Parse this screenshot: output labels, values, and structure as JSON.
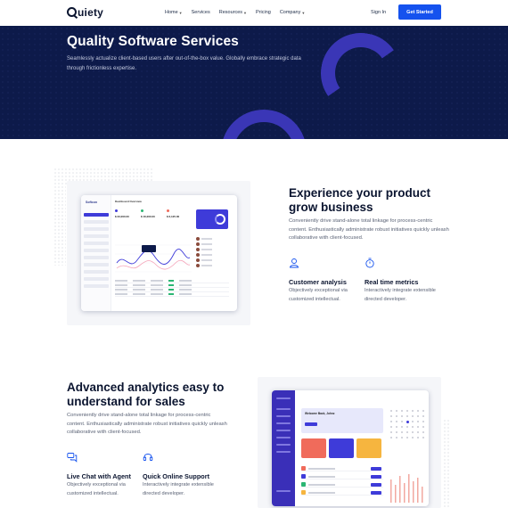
{
  "nav": {
    "logo": "uiety",
    "items": [
      {
        "label": "Home",
        "dropdown": true
      },
      {
        "label": "Services",
        "dropdown": false
      },
      {
        "label": "Resources",
        "dropdown": true
      },
      {
        "label": "Pricing",
        "dropdown": false
      },
      {
        "label": "Company",
        "dropdown": true
      }
    ],
    "sign_in": "Sign In",
    "cta": "Get Started"
  },
  "hero": {
    "title": "Quality Software Services",
    "text": "Seamlessly actualize client-based users after out-of-the-box value. Globally embrace strategic data through frictionless expertise."
  },
  "section2": {
    "title": "Experience your product grow business",
    "text": "Conveniently drive stand-alone total linkage for process-centric content. Enthusiastically administrate robust initiatives quickly unleash collaborative with client-focused.",
    "features": [
      {
        "icon": "user-icon",
        "title": "Customer analysis",
        "text": "Objectively exceptional via customized intellectual."
      },
      {
        "icon": "stopwatch-icon",
        "title": "Real time metrics",
        "text": "Interactively integrate extensible directed developer."
      }
    ]
  },
  "section3": {
    "title": "Advanced analytics easy to understand for sales",
    "text": "Conveniently drive stand-alone total linkage for process-centric content. Enthusiastically administrate robust initiatives quickly unleash collaborative with client-focused.",
    "features": [
      {
        "icon": "chat-icon",
        "title": "Live Chat with Agent",
        "text": "Objectively exceptional via customized intellectual."
      },
      {
        "icon": "headset-icon",
        "title": "Quick Online Support",
        "text": "Interactively integrate extensible directed developer."
      }
    ]
  },
  "colors": {
    "brand": "#1552ee",
    "hero_bg": "#0d1a4a",
    "accent_shape": "#3a36b6"
  }
}
